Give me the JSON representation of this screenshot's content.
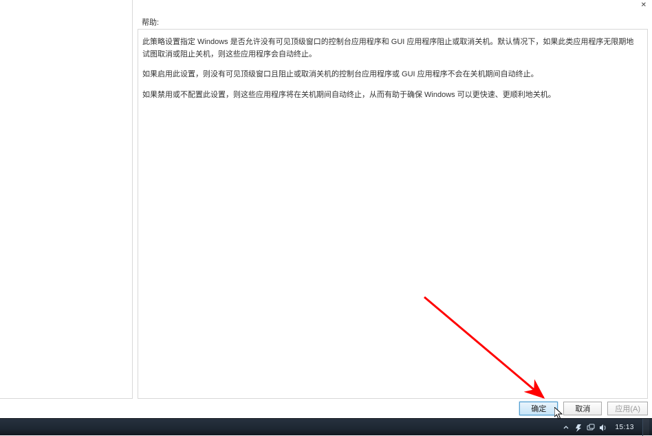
{
  "window": {
    "closeGlyph": "✕"
  },
  "help": {
    "label": "帮助:"
  },
  "content": {
    "p1": "此策略设置指定 Windows 是否允许没有可见顶级窗口的控制台应用程序和 GUI 应用程序阻止或取消关机。默认情况下，如果此类应用程序无限期地试图取消或阻止关机，则这些应用程序会自动终止。",
    "p2": "如果启用此设置，则没有可见顶级窗口且阻止或取消关机的控制台应用程序或 GUI 应用程序不会在关机期间自动终止。",
    "p3": "如果禁用或不配置此设置，则这些应用程序将在关机期间自动终止，从而有助于确保 Windows 可以更快速、更顺利地关机。"
  },
  "buttons": {
    "ok": "确定",
    "cancel": "取消",
    "apply": "应用(A)"
  },
  "taskbar": {
    "clock": "15:13"
  }
}
